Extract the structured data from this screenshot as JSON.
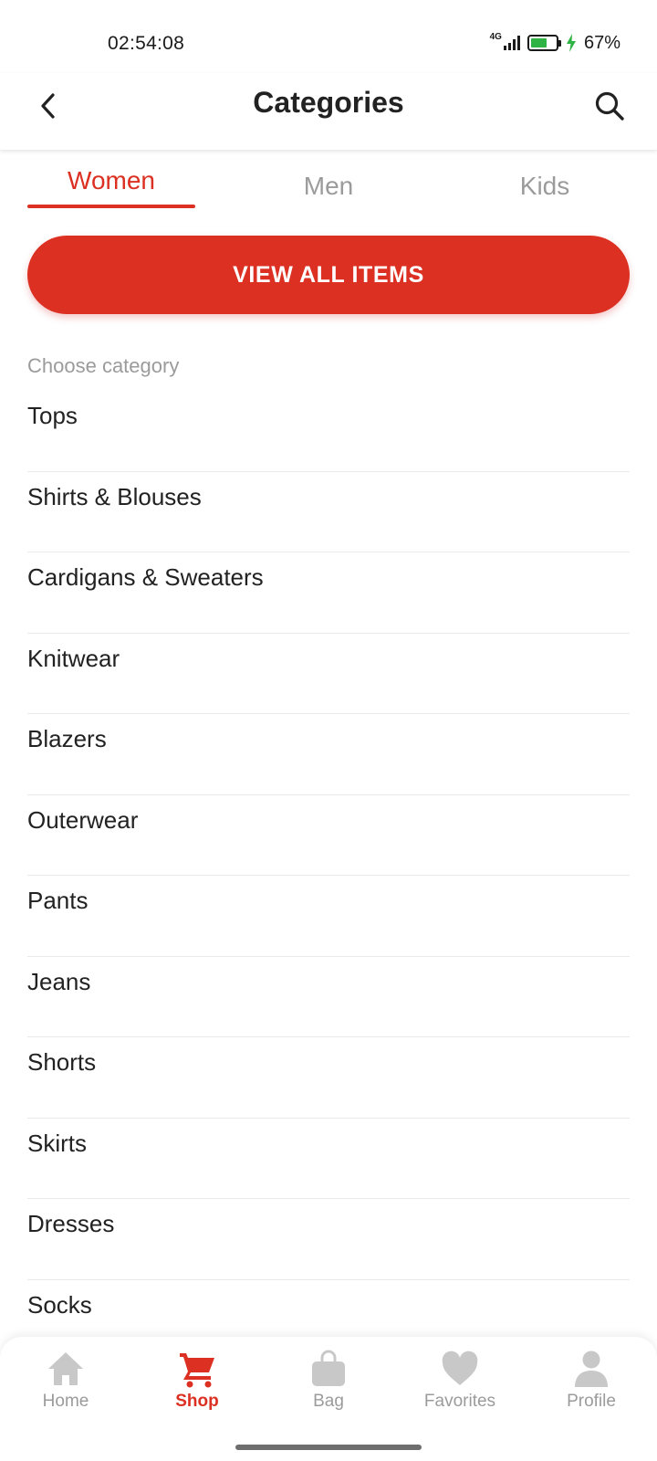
{
  "status_bar": {
    "time": "02:54:08",
    "network": "4G",
    "battery_percent": "67%",
    "battery_level": 0.67,
    "battery_color": "#2fb344"
  },
  "header": {
    "title": "Categories",
    "back_icon": "chevron-left-icon",
    "search_icon": "search-icon"
  },
  "tabs": [
    {
      "label": "Women",
      "active": true
    },
    {
      "label": "Men",
      "active": false
    },
    {
      "label": "Kids",
      "active": false
    }
  ],
  "view_all_button": "VIEW ALL ITEMS",
  "choose_label": "Choose category",
  "categories": [
    "Tops",
    "Shirts & Blouses",
    "Cardigans & Sweaters",
    "Knitwear",
    "Blazers",
    "Outerwear",
    "Pants",
    "Jeans",
    "Shorts",
    "Skirts",
    "Dresses",
    "Socks"
  ],
  "bottom_nav": [
    {
      "label": "Home",
      "icon": "home-icon",
      "active": false
    },
    {
      "label": "Shop",
      "icon": "cart-icon",
      "active": true
    },
    {
      "label": "Bag",
      "icon": "bag-icon",
      "active": false
    },
    {
      "label": "Favorites",
      "icon": "heart-icon",
      "active": false
    },
    {
      "label": "Profile",
      "icon": "profile-icon",
      "active": false
    }
  ],
  "colors": {
    "accent": "#db3022",
    "inactive": "#9b9b9b",
    "text": "#222222"
  }
}
